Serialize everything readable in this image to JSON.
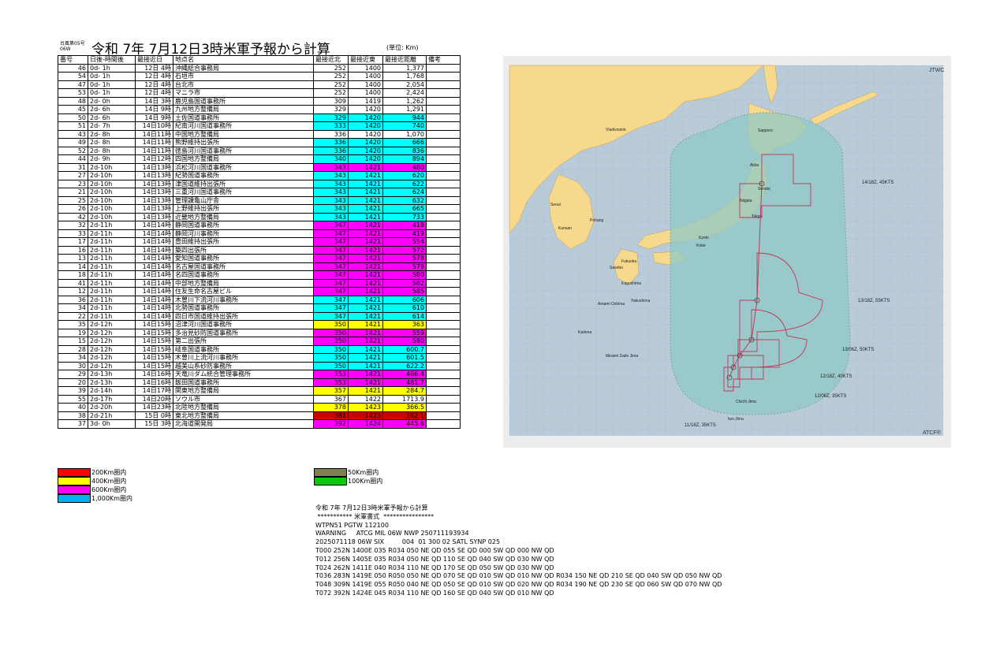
{
  "header": {
    "typhoon_no": "台風第05号",
    "typhoon_code": "06W",
    "title": "令和 7年 7月12日3時米軍予報から計算",
    "unit": "(単位: Km)"
  },
  "table": {
    "columns": [
      "番号",
      "日後-時間後",
      "最接近日",
      "地点名",
      "最接近北",
      "最接近東",
      "最接近距離",
      "備考"
    ],
    "rows": [
      {
        "no": "46",
        "after": "0d- 1h",
        "date": "12日 4時",
        "name": "沖縄総合事務局",
        "lat": "252",
        "lon": "1400",
        "dist": "1,377",
        "color": "#ffffff"
      },
      {
        "no": "54",
        "after": "0d- 1h",
        "date": "12日 4時",
        "name": "石垣市",
        "lat": "252",
        "lon": "1400",
        "dist": "1,768",
        "color": "#ffffff"
      },
      {
        "no": "47",
        "after": "0d- 1h",
        "date": "12日 4時",
        "name": "台北市",
        "lat": "252",
        "lon": "1400",
        "dist": "2,054",
        "color": "#ffffff"
      },
      {
        "no": "53",
        "after": "0d- 1h",
        "date": "12日 4時",
        "name": "マニラ市",
        "lat": "252",
        "lon": "1400",
        "dist": "2,424",
        "color": "#ffffff"
      },
      {
        "no": "48",
        "after": "2d- 0h",
        "date": "14日 3時",
        "name": "鹿児島国道事務所",
        "lat": "309",
        "lon": "1419",
        "dist": "1,262",
        "color": "#ffffff"
      },
      {
        "no": "45",
        "after": "2d- 6h",
        "date": "14日 9時",
        "name": "九州地方整備局",
        "lat": "329",
        "lon": "1420",
        "dist": "1,291",
        "color": "#ffffff"
      },
      {
        "no": "50",
        "after": "2d- 6h",
        "date": "14日 9時",
        "name": "土佐国道事務所",
        "lat": "329",
        "lon": "1420",
        "dist": "944",
        "color": "#00ffff"
      },
      {
        "no": "51",
        "after": "2d- 7h",
        "date": "14日10時",
        "name": "紀南河川国道事務所",
        "lat": "333",
        "lon": "1420",
        "dist": "740",
        "color": "#00ffff"
      },
      {
        "no": "43",
        "after": "2d- 8h",
        "date": "14日11時",
        "name": "中国地方整備局",
        "lat": "336",
        "lon": "1420",
        "dist": "1,070",
        "color": "#ffffff"
      },
      {
        "no": "49",
        "after": "2d- 8h",
        "date": "14日11時",
        "name": "熊野維持出張所",
        "lat": "336",
        "lon": "1420",
        "dist": "666",
        "color": "#00ffff"
      },
      {
        "no": "52",
        "after": "2d- 8h",
        "date": "14日11時",
        "name": "徳島河川国道事務所",
        "lat": "336",
        "lon": "1420",
        "dist": "836",
        "color": "#00ffff"
      },
      {
        "no": "44",
        "after": "2d- 9h",
        "date": "14日12時",
        "name": "四国地方整備局",
        "lat": "340",
        "lon": "1420",
        "dist": "894",
        "color": "#00ffff"
      },
      {
        "no": "31",
        "after": "2d-10h",
        "date": "14日13時",
        "name": "浜松河川国道事務所",
        "lat": "343",
        "lon": "1421",
        "dist": "480",
        "color": "#ff00ff"
      },
      {
        "no": "27",
        "after": "2d-10h",
        "date": "14日13時",
        "name": "紀勢国道事務所",
        "lat": "343",
        "lon": "1421",
        "dist": "620",
        "color": "#00ffff"
      },
      {
        "no": "23",
        "after": "2d-10h",
        "date": "14日13時",
        "name": "津国道維持出張所",
        "lat": "343",
        "lon": "1421",
        "dist": "622",
        "color": "#00ffff"
      },
      {
        "no": "21",
        "after": "2d-10h",
        "date": "14日13時",
        "name": "三重河川国道事務所",
        "lat": "343",
        "lon": "1421",
        "dist": "624",
        "color": "#00ffff"
      },
      {
        "no": "25",
        "after": "2d-10h",
        "date": "14日13時",
        "name": "管理課亀山庁舎",
        "lat": "343",
        "lon": "1421",
        "dist": "632",
        "color": "#00ffff"
      },
      {
        "no": "26",
        "after": "2d-10h",
        "date": "14日13時",
        "name": "上野維持出張所",
        "lat": "343",
        "lon": "1421",
        "dist": "665",
        "color": "#00ffff"
      },
      {
        "no": "42",
        "after": "2d-10h",
        "date": "14日13時",
        "name": "近畿地方整備局",
        "lat": "343",
        "lon": "1421",
        "dist": "733",
        "color": "#00ffff"
      },
      {
        "no": "32",
        "after": "2d-11h",
        "date": "14日14時",
        "name": "静岡国道事務所",
        "lat": "347",
        "lon": "1421",
        "dist": "418",
        "color": "#ff00ff"
      },
      {
        "no": "33",
        "after": "2d-11h",
        "date": "14日14時",
        "name": "静岡河川事務所",
        "lat": "347",
        "lon": "1421",
        "dist": "419",
        "color": "#ff00ff"
      },
      {
        "no": "17",
        "after": "2d-11h",
        "date": "14日14時",
        "name": "豊田維持出張所",
        "lat": "347",
        "lon": "1421",
        "dist": "554",
        "color": "#ff00ff"
      },
      {
        "no": "16",
        "after": "2d-11h",
        "date": "14日14時",
        "name": "築四出張所",
        "lat": "347",
        "lon": "1421",
        "dist": "572",
        "color": "#ff00ff"
      },
      {
        "no": "13",
        "after": "2d-11h",
        "date": "14日14時",
        "name": "愛知国道事務所",
        "lat": "347",
        "lon": "1421",
        "dist": "578",
        "color": "#ff00ff"
      },
      {
        "no": "14",
        "after": "2d-11h",
        "date": "14日14時",
        "name": "名古屋国道事務所",
        "lat": "347",
        "lon": "1421",
        "dist": "579",
        "color": "#ff00ff"
      },
      {
        "no": "18",
        "after": "2d-11h",
        "date": "14日14時",
        "name": "名四国道事務所",
        "lat": "347",
        "lon": "1421",
        "dist": "580",
        "color": "#ff00ff"
      },
      {
        "no": "41",
        "after": "2d-11h",
        "date": "14日14時",
        "name": "中部地方整備局",
        "lat": "347",
        "lon": "1421",
        "dist": "582",
        "color": "#ff00ff"
      },
      {
        "no": "12",
        "after": "2d-11h",
        "date": "14日14時",
        "name": "住友生命名古屋ビル",
        "lat": "347",
        "lon": "1421",
        "dist": "585",
        "color": "#ff00ff"
      },
      {
        "no": "36",
        "after": "2d-11h",
        "date": "14日14時",
        "name": "木曽川下流河川事務所",
        "lat": "347",
        "lon": "1421",
        "dist": "606",
        "color": "#00ffff"
      },
      {
        "no": "34",
        "after": "2d-11h",
        "date": "14日14時",
        "name": "北勢国道事務所",
        "lat": "347",
        "lon": "1421",
        "dist": "610",
        "color": "#00ffff"
      },
      {
        "no": "22",
        "after": "2d-11h",
        "date": "14日14時",
        "name": "四日市国道維持出張所",
        "lat": "347",
        "lon": "1421",
        "dist": "614",
        "color": "#00ffff"
      },
      {
        "no": "35",
        "after": "2d-12h",
        "date": "14日15時",
        "name": "沼津河川国道事務所",
        "lat": "350",
        "lon": "1421",
        "dist": "363",
        "color": "#ffff00"
      },
      {
        "no": "19",
        "after": "2d-12h",
        "date": "14日15時",
        "name": "多治見砂防国道事務所",
        "lat": "350",
        "lon": "1421",
        "dist": "559",
        "color": "#ff00ff"
      },
      {
        "no": "15",
        "after": "2d-12h",
        "date": "14日15時",
        "name": "第二出張所",
        "lat": "350",
        "lon": "1421",
        "dist": "580",
        "color": "#ff00ff"
      },
      {
        "no": "28",
        "after": "2d-12h",
        "date": "14日15時",
        "name": "岐阜国道事務所",
        "lat": "350",
        "lon": "1421",
        "dist": "600.7",
        "color": "#00ffff"
      },
      {
        "no": "34",
        "after": "2d-12h",
        "date": "14日15時",
        "name": "木曽川上流河川事務所",
        "lat": "350",
        "lon": "1421",
        "dist": "601.5",
        "color": "#00ffff"
      },
      {
        "no": "30",
        "after": "2d-12h",
        "date": "14日15時",
        "name": "越美山系砂防事務所",
        "lat": "350",
        "lon": "1421",
        "dist": "622.2",
        "color": "#00ffff"
      },
      {
        "no": "29",
        "after": "2d-13h",
        "date": "14日16時",
        "name": "天竜川ダム統合管理事務所",
        "lat": "353",
        "lon": "1421",
        "dist": "466.4",
        "color": "#ff00ff"
      },
      {
        "no": "20",
        "after": "2d-13h",
        "date": "14日16時",
        "name": "飯田国道事務所",
        "lat": "353",
        "lon": "1421",
        "dist": "481.7",
        "color": "#ff00ff"
      },
      {
        "no": "39",
        "after": "2d-14h",
        "date": "14日17時",
        "name": "関東地方整備局",
        "lat": "357",
        "lon": "1421",
        "dist": "284.7",
        "color": "#ffff00"
      },
      {
        "no": "55",
        "after": "2d-17h",
        "date": "14日20時",
        "name": "ソウル市",
        "lat": "367",
        "lon": "1422",
        "dist": "1713.9",
        "color": "#ffffff"
      },
      {
        "no": "40",
        "after": "2d-20h",
        "date": "14日23時",
        "name": "北陸地方整備局",
        "lat": "378",
        "lon": "1423",
        "dist": "366.5",
        "color": "#ffff00"
      },
      {
        "no": "38",
        "after": "2d-21h",
        "date": "15日 0時",
        "name": "東北地方整備局",
        "lat": "381",
        "lon": "1423",
        "dist": "162.1",
        "color": "#cc0000"
      },
      {
        "no": "37",
        "after": "3d- 0h",
        "date": "15日 3時",
        "name": "北海道開発局",
        "lat": "392",
        "lon": "1424",
        "dist": "445.6",
        "color": "#ff00ff"
      }
    ]
  },
  "legend_left": [
    {
      "label": "200Km圏内",
      "color": "#ff0000"
    },
    {
      "label": "400Km圏内",
      "color": "#ffff00"
    },
    {
      "label": "600Km圏内",
      "color": "#ff00ff"
    },
    {
      "label": "1,000Km圏内",
      "color": "#00b0f0"
    }
  ],
  "legend_right": [
    {
      "label": "50Km圏内",
      "color": "#7f7f4f"
    },
    {
      "label": "100Km圏内",
      "color": "#00cc00"
    }
  ],
  "message": {
    "lines": [
      "令和 7年 7月12日3時米軍予報から計算",
      " *********** 米軍書式  ****************",
      "WTPN51 PGTW 112100",
      "WARNING     ATCG MIL 06W NWP 250711193934",
      "2025071118 06W SIX         004  01 300 02 SATL SYNP 025",
      "T000 252N 1400E 035 R034 050 NE QD 055 SE QD 000 SW QD 000 NW QD",
      "T012 256N 1405E 035 R034 050 NE QD 110 SE QD 040 SW QD 030 NW QD",
      "T024 262N 1411E 040 R034 110 NE QD 170 SE QD 050 SW QD 030 NW QD",
      "T036 283N 1419E 050 R050 050 NE QD 070 SE QD 010 SW QD 010 NW QD R034 150 NE QD 210 SE QD 040 SW QD 050 NW QD",
      "T048 309N 1419E 055 R050 040 NE QD 050 SE QD 010 SW QD 020 NW QD R034 190 NE QD 230 SE QD 060 SW QD 070 NW QD",
      "T072 392N 1424E 045 R034 110 NE QD 160 SE QD 040 SW QD 010 NW QD"
    ]
  },
  "map": {
    "agency": "JTWC",
    "credit": "ATCF®",
    "forecast_labels": [
      "14/18Z, 45KTS",
      "13/18Z, 55KTS",
      "13/06Z, 50KTS",
      "12/18Z, 40KTS",
      "12/06Z, 35KTS",
      "11/18Z, 35KTS"
    ],
    "place_labels": [
      "Sapporo",
      "Akita",
      "Sendai",
      "Niigata",
      "Tokyo",
      "Kobe",
      "Kyoto",
      "Fukuoka",
      "Seoul",
      "Pohang",
      "Kunsan",
      "Sasebo",
      "Yakushima",
      "Kagoshima",
      "Amami Oshima",
      "Kadena",
      "Minami Daito Jima",
      "Iwo Jima",
      "Chichi Jima",
      "Vladivostok"
    ],
    "colors": {
      "sea": "#b9cbd9",
      "land": "#f6d98c",
      "danger": "#8fc8c4",
      "track": "#c0395a",
      "grid": "#8aa0b2"
    }
  }
}
